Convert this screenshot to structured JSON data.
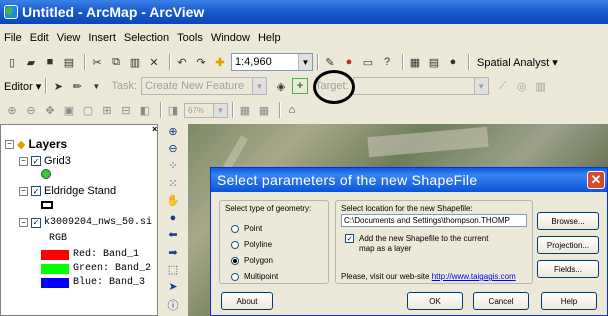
{
  "window": {
    "title": "Untitled - ArcMap - ArcView"
  },
  "menu": [
    "File",
    "Edit",
    "View",
    "Insert",
    "Selection",
    "Tools",
    "Window",
    "Help"
  ],
  "toolbar": {
    "scale": "1:4,960",
    "spatial_analyst": "Spatial Analyst"
  },
  "editor_toolbar": {
    "editor": "Editor",
    "task_label": "Task:",
    "task_value": "Create New Feature",
    "target_label": "Target:"
  },
  "zoom": {
    "value": "67%"
  },
  "toc": {
    "title": "Layers",
    "layers": [
      {
        "name": "Grid3",
        "checked": true
      },
      {
        "name": "Eldridge Stand",
        "checked": true
      },
      {
        "name": "k3009204_nws_50.si",
        "checked": true
      }
    ],
    "raster_legend": {
      "title": "RGB",
      "bands": [
        {
          "label": "Red:",
          "band": "Band_1",
          "color": "#ff0000"
        },
        {
          "label": "Green:",
          "band": "Band_2",
          "color": "#00ff00"
        },
        {
          "label": "Blue:",
          "band": "Band_3",
          "color": "#0000ff"
        }
      ]
    }
  },
  "dialog": {
    "title": "Select parameters of the new ShapeFile",
    "geometry_label": "Select type of geometry:",
    "geometry_options": [
      "Point",
      "Polyline",
      "Polygon",
      "Multipoint"
    ],
    "geometry_selected": "Polygon",
    "location_label": "Select location for the new Shapefile:",
    "location_value": "C:\\Documents and Settings\\thompson.THOMP",
    "add_label_line1": "Add the new Shapefile to the current",
    "add_label_line2": "map as a layer",
    "add_checked": true,
    "browse": "Browse...",
    "projection": "Projection...",
    "fields": "Fields...",
    "visit_text": "Please, visit our web-site",
    "visit_link": "http://www.taigagis.com",
    "about": "About",
    "ok": "OK",
    "cancel": "Cancel",
    "help": "Help"
  },
  "colors": {
    "title_bar": "#0a46b8",
    "dialog_title": "#0953d8",
    "close": "#d84a2c",
    "link": "#0000ff"
  }
}
